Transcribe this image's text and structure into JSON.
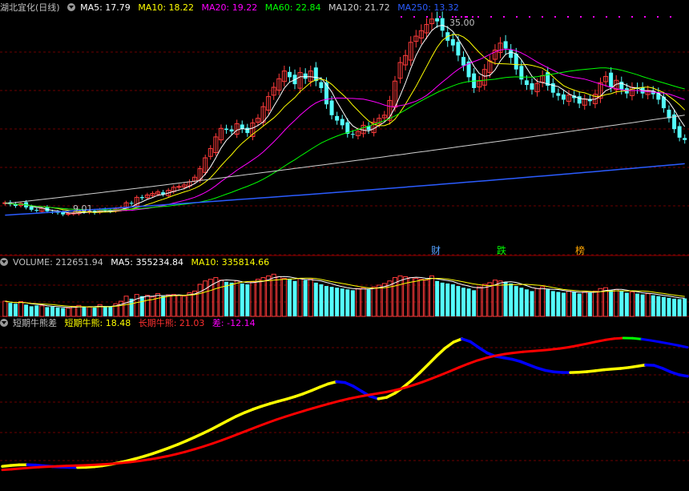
{
  "price_header": {
    "title": "湖北宜化(日线)",
    "ma5": "MA5: 17.79",
    "ma10": "MA10: 18.22",
    "ma20": "MA20: 19.22",
    "ma60": "MA60: 22.84",
    "ma120": "MA120: 21.72",
    "ma250": "MA250: 13.32"
  },
  "volume_header": {
    "label": "VOLUME: 212651.94",
    "ma5": "MA5: 355234.84",
    "ma10": "MA10: 335814.66"
  },
  "indicator_header": {
    "title": "短期牛熊差",
    "short": "短期牛熊: 18.48",
    "long": "长期牛熊: 21.03",
    "diff": "差: -12.14"
  },
  "annotations": {
    "high_label": "35.00",
    "low_label": "9.01",
    "event_cai": "财",
    "event_die": "跌",
    "event_bang": "榜"
  },
  "colors": {
    "up": "#ff3b3b",
    "down": "#54fcfc",
    "ma5": "#ffffff",
    "ma10": "#ffff00",
    "ma20": "#ff00ff",
    "ma60": "#00ff00",
    "ma120": "#d0d0d0",
    "ma250": "#2b5cff",
    "short_line": "#ffff00",
    "long_line": "#ff0000",
    "falling": "#0000ff",
    "green": "#00ff00"
  },
  "chart_data": {
    "type": "candlestick",
    "last_values": {
      "ma5": 17.79,
      "ma10": 18.22,
      "ma20": 19.22,
      "ma60": 22.84,
      "ma120": 21.72,
      "ma250": 13.32,
      "volume": 212651.94,
      "vol_ma5": 355234.84,
      "vol_ma10": 335814.66,
      "short_bull_bear": 18.48,
      "long_bull_bear": 21.03,
      "diff": -12.14
    },
    "price_high": 35.0,
    "price_low": 9.01,
    "close_series": [
      10.6,
      10.4,
      10.2,
      10.5,
      10.0,
      9.7,
      9.6,
      9.9,
      9.5,
      9.4,
      9.3,
      9.1,
      9.2,
      9.3,
      9.6,
      9.4,
      9.5,
      9.3,
      9.7,
      9.6,
      9.5,
      9.8,
      10.0,
      10.6,
      10.5,
      11.3,
      11.2,
      11.6,
      11.8,
      12.0,
      11.7,
      12.2,
      12.6,
      12.7,
      12.9,
      13.3,
      13.9,
      15.0,
      16.4,
      17.6,
      19.1,
      20.2,
      20.0,
      19.8,
      20.8,
      20.1,
      19.6,
      20.9,
      21.5,
      23.0,
      24.3,
      25.5,
      26.6,
      27.6,
      26.8,
      25.9,
      27.4,
      26.6,
      27.6,
      26.3,
      25.4,
      23.3,
      21.9,
      21.2,
      20.6,
      19.5,
      19.4,
      19.8,
      20.6,
      20.0,
      21.0,
      21.5,
      21.9,
      23.8,
      26.3,
      28.7,
      29.6,
      31.3,
      32.1,
      32.8,
      33.6,
      34.3,
      34.0,
      32.8,
      31.5,
      30.9,
      29.6,
      28.3,
      26.8,
      25.4,
      26.3,
      27.8,
      28.9,
      30.3,
      31.2,
      30.5,
      29.3,
      27.8,
      26.5,
      25.8,
      25.2,
      26.0,
      27.0,
      25.7,
      24.8,
      24.4,
      23.9,
      24.5,
      24.1,
      23.4,
      24.0,
      23.7,
      24.6,
      26.1,
      26.9,
      25.5,
      26.4,
      25.2,
      24.7,
      25.5,
      25.3,
      24.7,
      25.1,
      24.6,
      23.9,
      22.8,
      21.5,
      20.1,
      19.0,
      18.7
    ],
    "volume_series": [
      180000,
      160000,
      150000,
      175000,
      140000,
      120000,
      130000,
      125000,
      110000,
      115000,
      105000,
      100000,
      98000,
      120000,
      130000,
      115000,
      110000,
      105000,
      140000,
      120000,
      115000,
      150000,
      180000,
      240000,
      210000,
      260000,
      240000,
      250000,
      230000,
      270000,
      240000,
      255000,
      260000,
      250000,
      240000,
      280000,
      300000,
      380000,
      420000,
      440000,
      460000,
      430000,
      410000,
      400000,
      420000,
      390000,
      380000,
      410000,
      440000,
      460000,
      480000,
      500000,
      470000,
      450000,
      440000,
      420000,
      450000,
      430000,
      440000,
      400000,
      380000,
      360000,
      350000,
      340000,
      330000,
      320000,
      310000,
      330000,
      340000,
      320000,
      350000,
      370000,
      390000,
      420000,
      460000,
      480000,
      470000,
      460000,
      450000,
      440000,
      430000,
      480000,
      420000,
      400000,
      390000,
      380000,
      360000,
      340000,
      330000,
      310000,
      350000,
      380000,
      400000,
      430000,
      420000,
      410000,
      390000,
      360000,
      340000,
      320000,
      300000,
      330000,
      350000,
      320000,
      300000,
      290000,
      280000,
      300000,
      290000,
      270000,
      290000,
      280000,
      300000,
      330000,
      340000,
      310000,
      320000,
      300000,
      280000,
      290000,
      270000,
      260000,
      270000,
      250000,
      240000,
      230000,
      220000,
      210000,
      205000,
      212652
    ],
    "short_line_series": [
      18.4,
      19.2,
      19.8,
      19.9,
      19.6,
      18.9,
      18.2,
      17.7,
      17.4,
      17.3,
      17.5,
      18.1,
      19.0,
      20.4,
      22.0,
      23.8,
      25.9,
      28.2,
      30.7,
      33.5,
      36.4,
      39.5,
      42.9,
      46.5,
      50.2,
      54.1,
      58.3,
      62.6,
      66.7,
      70.3,
      73.5,
      76.3,
      78.8,
      81.1,
      83.3,
      85.7,
      88.4,
      91.5,
      94.9,
      98.0,
      100.1,
      99.3,
      95.8,
      90.9,
      86.1,
      83.6,
      85.0,
      89.1,
      94.8,
      101.5,
      109.0,
      117.0,
      125.1,
      132.5,
      138.3,
      141.5,
      138.8,
      133.2,
      128.0,
      124.7,
      123.2,
      121.8,
      119.6,
      116.5,
      113.4,
      111.0,
      109.6,
      109.0,
      108.9,
      109.2,
      109.8,
      110.7,
      111.6,
      112.3,
      112.9,
      113.8,
      115.0,
      116.3,
      115.9,
      113.1,
      109.5,
      106.8,
      105.4
    ],
    "long_line_series": [
      15.0,
      15.6,
      16.3,
      17.0,
      17.6,
      18.1,
      18.5,
      18.8,
      19.1,
      19.4,
      19.8,
      20.3,
      20.9,
      21.6,
      22.5,
      23.6,
      24.9,
      26.4,
      28.1,
      30.1,
      32.3,
      34.8,
      37.5,
      40.4,
      43.5,
      46.8,
      50.2,
      53.6,
      57.0,
      60.3,
      63.5,
      66.4,
      69.2,
      71.9,
      74.5,
      77.0,
      79.4,
      81.7,
      83.8,
      85.6,
      87.2,
      88.6,
      90.1,
      91.9,
      94.1,
      96.8,
      99.8,
      103.1,
      106.6,
      110.2,
      113.9,
      117.4,
      120.6,
      123.2,
      125.2,
      126.8,
      128.0,
      128.9,
      129.6,
      130.3,
      131.1,
      132.1,
      133.4,
      135.0,
      136.8,
      138.7,
      140.4,
      141.7,
      142.3,
      142.1,
      141.2,
      139.9,
      138.4,
      136.8,
      135.1,
      133.3
    ]
  }
}
